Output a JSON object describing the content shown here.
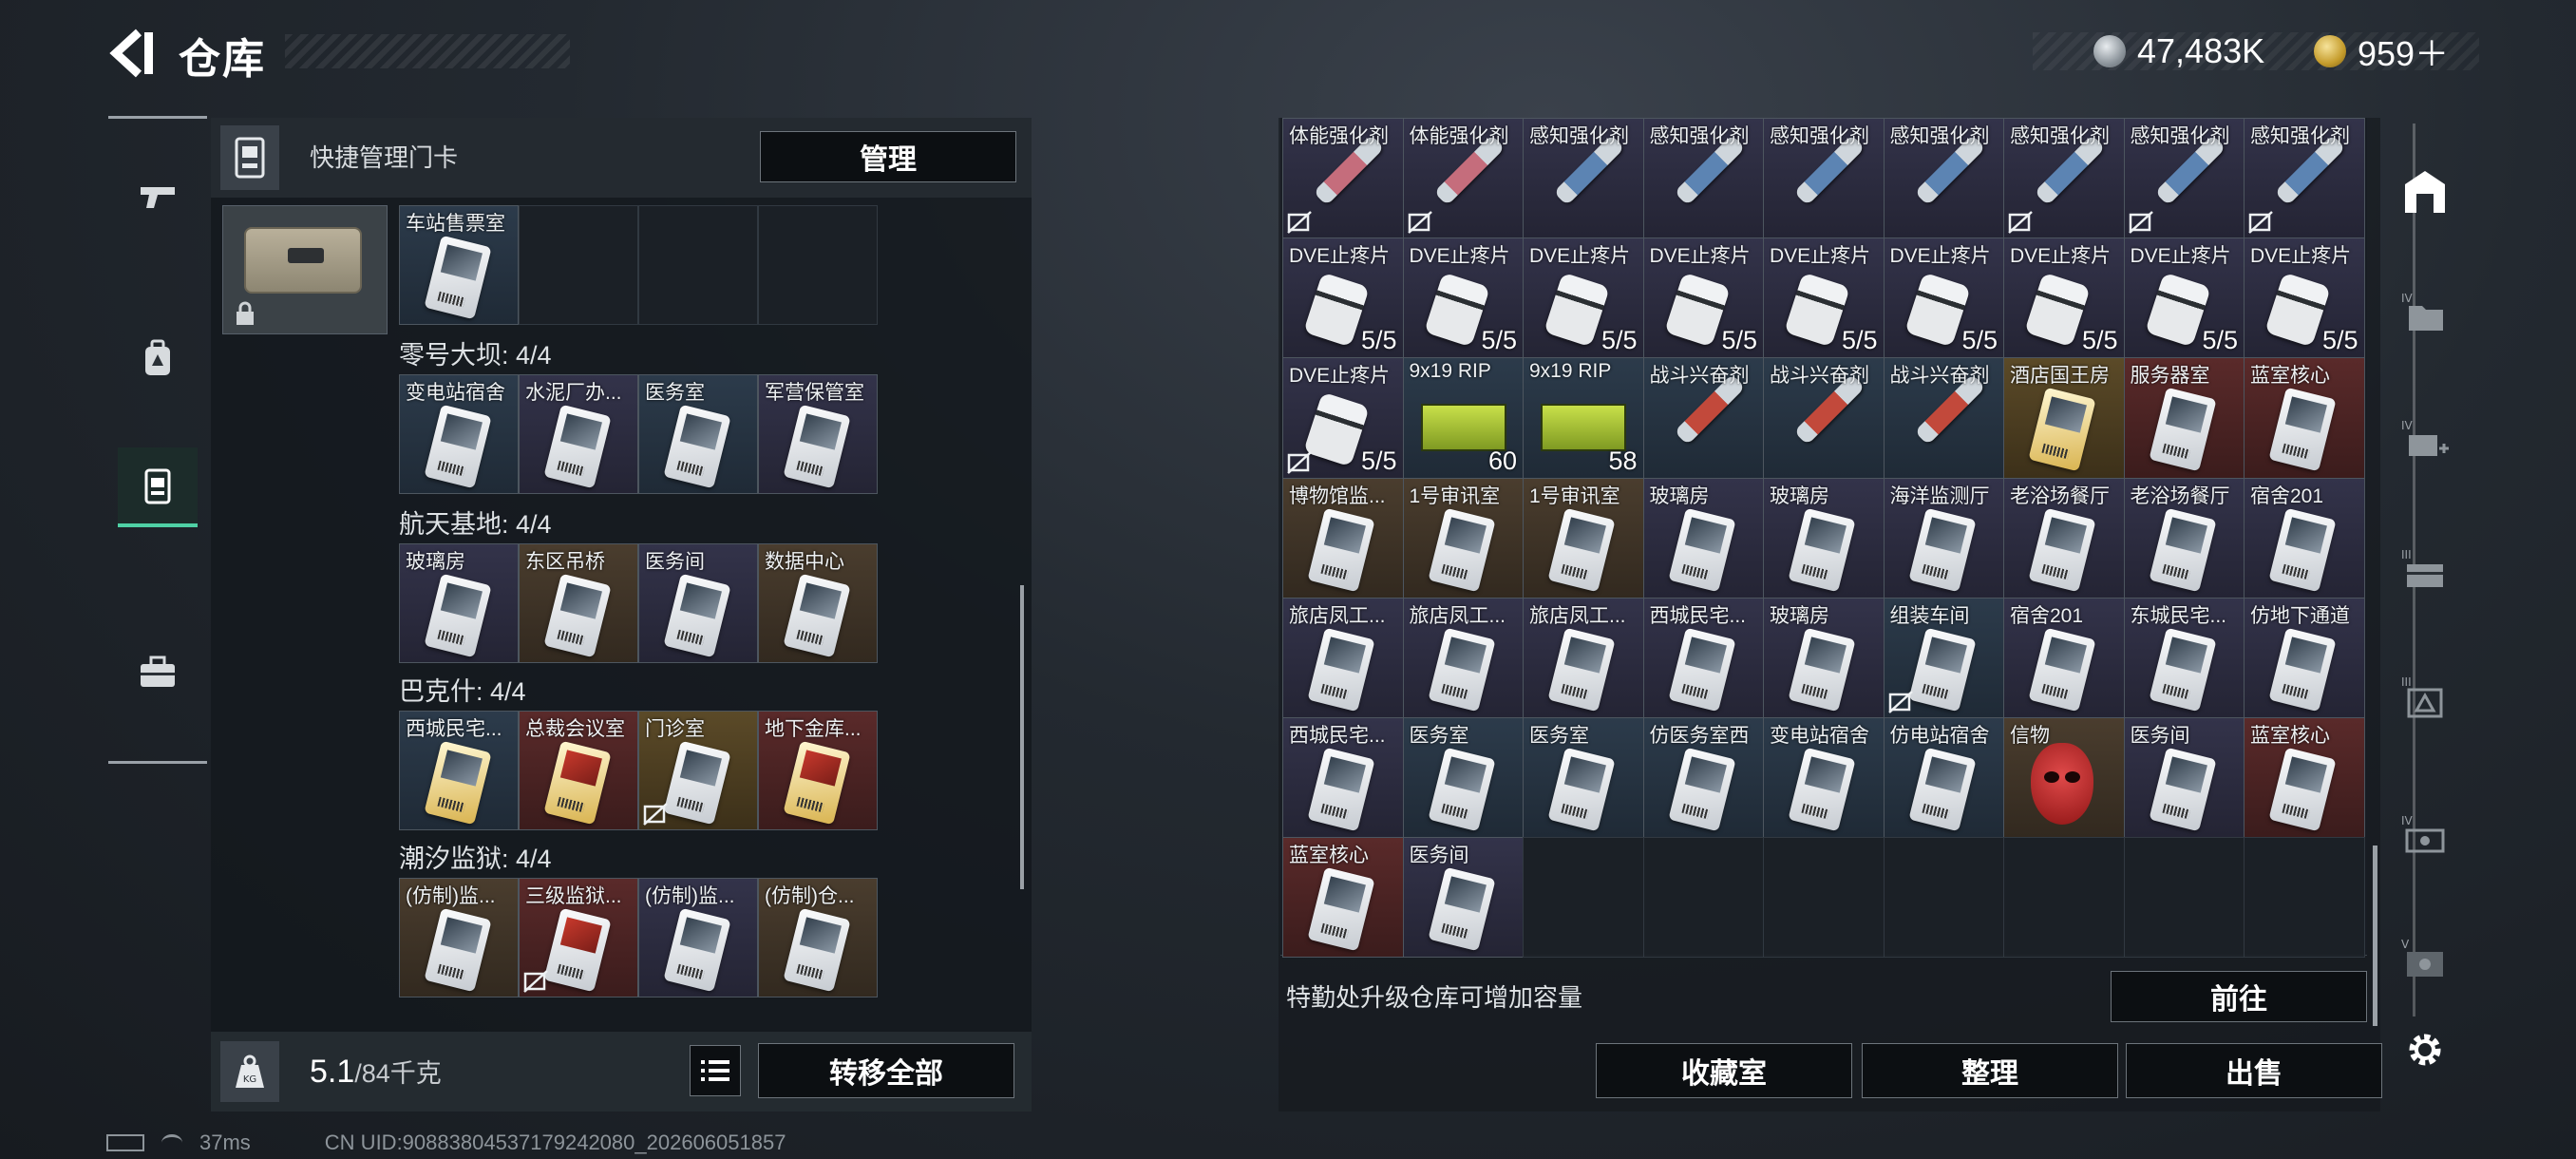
{
  "header": {
    "title": "仓库"
  },
  "currency": {
    "silver": "47,483K",
    "gold": "959＋"
  },
  "left_panel": {
    "title": "快捷管理门卡",
    "manage_label": "管理",
    "top_row": [
      "车站售票室",
      "",
      "",
      ""
    ],
    "sections": [
      {
        "title": "零号大坝: 4/4",
        "items": [
          "变电站宿舍",
          "水泥厂办...",
          "医务室",
          "军营保管室"
        ]
      },
      {
        "title": "航天基地: 4/4",
        "items": [
          "玻璃房",
          "东区吊桥",
          "医务间",
          "数据中心"
        ]
      },
      {
        "title": "巴克什: 4/4",
        "items": [
          "西城民宅...",
          "总裁会议室",
          "门诊室",
          "地下金库..."
        ]
      },
      {
        "title": "潮汐监狱: 4/4",
        "items": [
          "(仿制)监...",
          "三级监狱...",
          "(仿制)监...",
          "(仿制)仓..."
        ]
      }
    ],
    "weight_value": "5.1",
    "weight_capacity": "/84千克",
    "transfer_label": "转移全部"
  },
  "right_panel": {
    "rows": [
      [
        {
          "l": "体能强化剂"
        },
        {
          "l": "体能强化剂"
        },
        {
          "l": "感知强化剂"
        },
        {
          "l": "感知强化剂"
        },
        {
          "l": "感知强化剂"
        },
        {
          "l": "感知强化剂"
        },
        {
          "l": "感知强化剂"
        },
        {
          "l": "感知强化剂"
        },
        {
          "l": "感知强化剂"
        }
      ],
      [
        {
          "l": "DVE止疼片",
          "c": "5/5"
        },
        {
          "l": "DVE止疼片",
          "c": "5/5"
        },
        {
          "l": "DVE止疼片",
          "c": "5/5"
        },
        {
          "l": "DVE止疼片",
          "c": "5/5"
        },
        {
          "l": "DVE止疼片",
          "c": "5/5"
        },
        {
          "l": "DVE止疼片",
          "c": "5/5"
        },
        {
          "l": "DVE止疼片",
          "c": "5/5"
        },
        {
          "l": "DVE止疼片",
          "c": "5/5"
        },
        {
          "l": "DVE止疼片",
          "c": "5/5"
        }
      ],
      [
        {
          "l": "DVE止疼片",
          "c": "5/5"
        },
        {
          "l": "9x19 RIP",
          "c": "60"
        },
        {
          "l": "9x19 RIP",
          "c": "58"
        },
        {
          "l": "战斗兴奋剂"
        },
        {
          "l": "战斗兴奋剂"
        },
        {
          "l": "战斗兴奋剂"
        },
        {
          "l": "酒店国王房"
        },
        {
          "l": "服务器室"
        },
        {
          "l": "蓝室核心"
        }
      ],
      [
        {
          "l": "博物馆监..."
        },
        {
          "l": "1号审讯室"
        },
        {
          "l": "1号审讯室"
        },
        {
          "l": "玻璃房"
        },
        {
          "l": "玻璃房"
        },
        {
          "l": "海洋监测厅"
        },
        {
          "l": "老浴场餐厅"
        },
        {
          "l": "老浴场餐厅"
        },
        {
          "l": "宿舍201"
        }
      ],
      [
        {
          "l": "旅店凤工..."
        },
        {
          "l": "旅店凤工..."
        },
        {
          "l": "旅店凤工..."
        },
        {
          "l": "西城民宅..."
        },
        {
          "l": "玻璃房"
        },
        {
          "l": "组装车间"
        },
        {
          "l": "宿舍201"
        },
        {
          "l": "东城民宅..."
        },
        {
          "l": "仿地下通道"
        }
      ],
      [
        {
          "l": "西城民宅..."
        },
        {
          "l": "医务室"
        },
        {
          "l": "医务室"
        },
        {
          "l": "仿医务室西"
        },
        {
          "l": "变电站宿舍"
        },
        {
          "l": "仿电站宿舍"
        },
        {
          "l": "信物"
        },
        {
          "l": "医务间"
        },
        {
          "l": "蓝室核心"
        }
      ],
      [
        {
          "l": "蓝室核心"
        },
        {
          "l": "医务间"
        },
        {
          "l": ""
        },
        {
          "l": ""
        },
        {
          "l": ""
        },
        {
          "l": ""
        },
        {
          "l": ""
        },
        {
          "l": ""
        },
        {
          "l": ""
        }
      ]
    ],
    "note": "特勤处升级仓库可增加容量",
    "goto_label": "前往",
    "buttons": [
      "收藏室",
      "整理",
      "出售"
    ]
  },
  "status_bar": {
    "ping": "37ms",
    "uid": "CN UID:90883804537179242080_202606051857"
  },
  "colors": {
    "accent": "#4fd1a5",
    "panel": "#14181d"
  }
}
